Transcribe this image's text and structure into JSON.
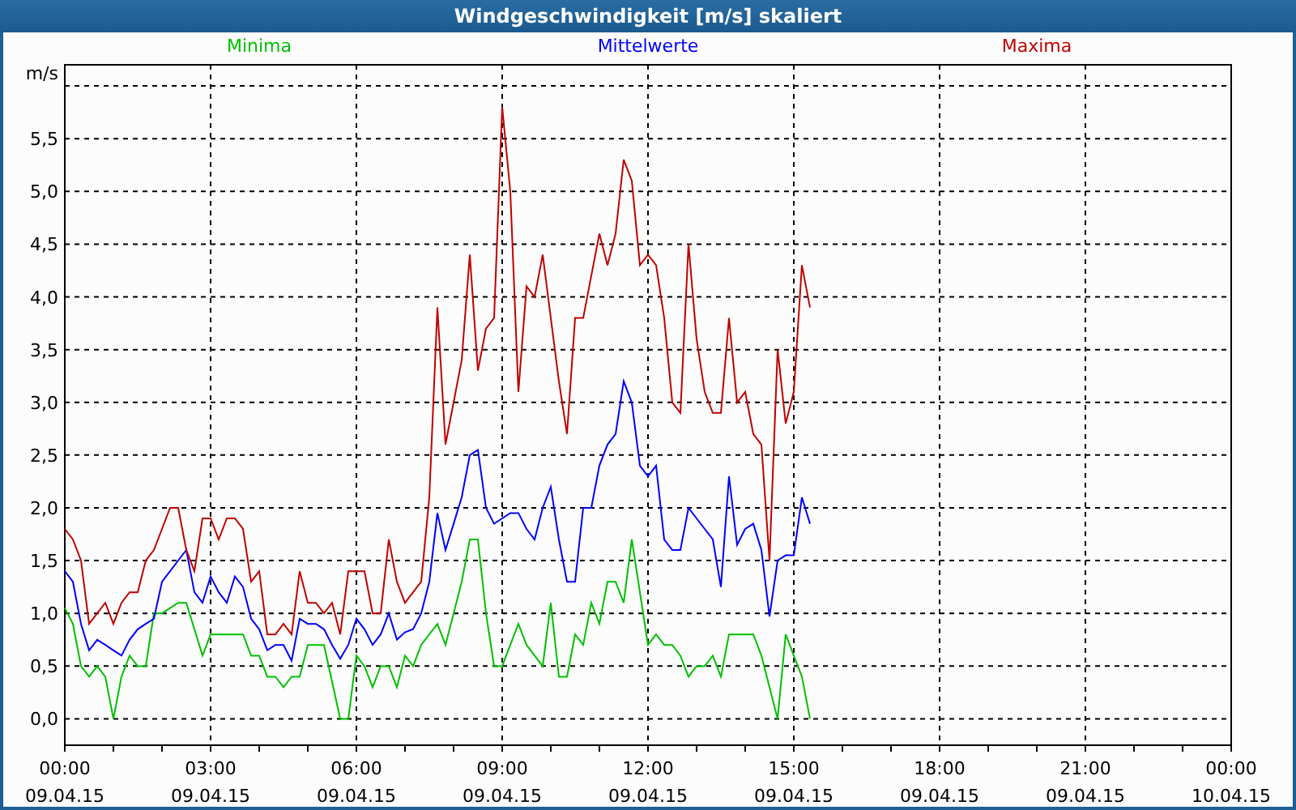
{
  "window": {
    "title": "Windgeschwindigkeit [m/s] skaliert"
  },
  "chart": {
    "chart_data": {
      "type": "line",
      "ylabel": "m/s",
      "grid": true,
      "categories": [
        "00:00\n09.04.15",
        null,
        null,
        null,
        null,
        null,
        null,
        null,
        null,
        null,
        null,
        null,
        null,
        null,
        null,
        null,
        null,
        null,
        "03:00\n09.04.15",
        null,
        null,
        null,
        null,
        null,
        null,
        null,
        null,
        null,
        null,
        null,
        null,
        null,
        null,
        null,
        null,
        null,
        "06:00\n09.04.15",
        null,
        null,
        null,
        null,
        null,
        null,
        null,
        null,
        null,
        null,
        null,
        null,
        null,
        null,
        null,
        null,
        null,
        "09:00\n09.04.15",
        null,
        null,
        null,
        null,
        null,
        null,
        null,
        null,
        null,
        null,
        null,
        null,
        null,
        null,
        null,
        null,
        null,
        "12:00\n09.04.15",
        null,
        null,
        null,
        null,
        null,
        null,
        null,
        null,
        null,
        null,
        null,
        null,
        null,
        null,
        null,
        null,
        null,
        "15:00\n09.04.15",
        null,
        null,
        null,
        null,
        null,
        null,
        null,
        null,
        null,
        null,
        null,
        null,
        null,
        null,
        null,
        null,
        null,
        "18:00\n09.04.15",
        null,
        null,
        null,
        null,
        null,
        null,
        null,
        null,
        null,
        null,
        null,
        null,
        null,
        null,
        null,
        null,
        null,
        "21:00\n09.04.15",
        null,
        null,
        null,
        null,
        null,
        null,
        null,
        null,
        null,
        null,
        null,
        null,
        null,
        null,
        null,
        null,
        null,
        "00:00\n10.04.15"
      ],
      "series": [
        {
          "name": "Minima",
          "color": "#00c000",
          "values": [
            1.05,
            0.9,
            0.5,
            0.4,
            0.5,
            0.4,
            0.0,
            0.4,
            0.6,
            0.5,
            0.5,
            1.0,
            1.0,
            1.05,
            1.1,
            1.1,
            0.85,
            0.6,
            0.8,
            0.8,
            0.8,
            0.8,
            0.8,
            0.6,
            0.6,
            0.4,
            0.4,
            0.3,
            0.4,
            0.4,
            0.7,
            0.7,
            0.7,
            0.35,
            0.0,
            0.0,
            0.6,
            0.5,
            0.3,
            0.5,
            0.5,
            0.3,
            0.6,
            0.5,
            0.7,
            0.8,
            0.9,
            0.7,
            1.0,
            1.3,
            1.7,
            1.7,
            1.0,
            0.5,
            0.5,
            0.7,
            0.9,
            0.7,
            0.6,
            0.5,
            1.1,
            0.4,
            0.4,
            0.8,
            0.7,
            1.1,
            0.9,
            1.3,
            1.3,
            1.1,
            1.7,
            1.2,
            0.7,
            0.8,
            0.7,
            0.7,
            0.6,
            0.4,
            0.5,
            0.5,
            0.6,
            0.4,
            0.8,
            0.8,
            0.8,
            0.8,
            0.6,
            0.3,
            0.0,
            0.8,
            0.6,
            0.4,
            0.0,
            null,
            null,
            null,
            null,
            null,
            null,
            null,
            null,
            null,
            null,
            null,
            null,
            null,
            null,
            null,
            null,
            null,
            null,
            null,
            null,
            null,
            null,
            null,
            null,
            null,
            null,
            null,
            null,
            null,
            null,
            null,
            null,
            null,
            null,
            null,
            null,
            null,
            null,
            null,
            null,
            null,
            null,
            null,
            null,
            null,
            null,
            null,
            null,
            null,
            null,
            null,
            null
          ]
        },
        {
          "name": "Mittelwerte",
          "color": "#0000ff",
          "values": [
            1.4,
            1.3,
            0.9,
            0.65,
            0.75,
            0.7,
            0.65,
            0.6,
            0.75,
            0.85,
            0.9,
            0.95,
            1.3,
            1.4,
            1.5,
            1.6,
            1.2,
            1.1,
            1.35,
            1.2,
            1.1,
            1.35,
            1.25,
            0.95,
            0.85,
            0.65,
            0.7,
            0.7,
            0.55,
            0.95,
            0.9,
            0.9,
            0.85,
            0.7,
            0.57,
            0.7,
            0.95,
            0.85,
            0.7,
            0.8,
            1.0,
            0.75,
            0.82,
            0.85,
            1.0,
            1.3,
            1.95,
            1.6,
            1.85,
            2.1,
            2.5,
            2.55,
            2.0,
            1.85,
            1.9,
            1.95,
            1.95,
            1.8,
            1.7,
            2.0,
            2.2,
            1.7,
            1.3,
            1.3,
            2.0,
            2.0,
            2.4,
            2.6,
            2.7,
            3.2,
            3.0,
            2.4,
            2.3,
            2.4,
            1.7,
            1.6,
            1.6,
            2.0,
            1.9,
            1.8,
            1.7,
            1.25,
            2.3,
            1.65,
            1.8,
            1.85,
            1.6,
            0.97,
            1.5,
            1.55,
            1.55,
            2.1,
            1.85,
            null,
            null,
            null,
            null,
            null,
            null,
            null,
            null,
            null,
            null,
            null,
            null,
            null,
            null,
            null,
            null,
            null,
            null,
            null,
            null,
            null,
            null,
            null,
            null,
            null,
            null,
            null,
            null,
            null,
            null,
            null,
            null,
            null,
            null,
            null,
            null,
            null,
            null,
            null,
            null,
            null,
            null,
            null,
            null,
            null,
            null,
            null,
            null,
            null,
            null,
            null,
            null
          ]
        },
        {
          "name": "Maxima",
          "color": "#c00000",
          "values": [
            1.8,
            1.7,
            1.5,
            0.9,
            1.0,
            1.1,
            0.9,
            1.1,
            1.2,
            1.2,
            1.5,
            1.6,
            1.8,
            2.0,
            2.0,
            1.6,
            1.4,
            1.9,
            1.9,
            1.7,
            1.9,
            1.9,
            1.8,
            1.3,
            1.4,
            0.8,
            0.8,
            0.9,
            0.8,
            1.4,
            1.1,
            1.1,
            1.0,
            1.1,
            0.8,
            1.4,
            1.4,
            1.4,
            1.0,
            1.0,
            1.7,
            1.3,
            1.1,
            1.2,
            1.3,
            2.1,
            3.9,
            2.6,
            3.0,
            3.4,
            4.4,
            3.3,
            3.7,
            3.8,
            5.8,
            5.0,
            3.1,
            4.1,
            4.0,
            4.4,
            3.8,
            3.2,
            2.7,
            3.8,
            3.8,
            4.2,
            4.6,
            4.3,
            4.6,
            5.3,
            5.1,
            4.3,
            4.4,
            4.3,
            3.8,
            3.0,
            2.9,
            4.5,
            3.6,
            3.1,
            2.9,
            2.9,
            3.8,
            3.0,
            3.1,
            2.7,
            2.6,
            1.5,
            3.5,
            2.8,
            3.1,
            4.3,
            3.9,
            null,
            null,
            null,
            null,
            null,
            null,
            null,
            null,
            null,
            null,
            null,
            null,
            null,
            null,
            null,
            null,
            null,
            null,
            null,
            null,
            null,
            null,
            null,
            null,
            null,
            null,
            null,
            null,
            null,
            null,
            null,
            null,
            null,
            null,
            null,
            null,
            null,
            null,
            null,
            null,
            null,
            null,
            null,
            null,
            null,
            null,
            null,
            null,
            null,
            null,
            null,
            null
          ]
        }
      ],
      "ylim": [
        -0.25,
        6.2
      ],
      "yticks": [
        {
          "value": 0,
          "label": "0,0"
        },
        {
          "value": 0.5,
          "label": "0,5"
        },
        {
          "value": 1,
          "label": "1,0"
        },
        {
          "value": 1.5,
          "label": "1,5"
        },
        {
          "value": 2,
          "label": "2,0"
        },
        {
          "value": 2.5,
          "label": "2,5"
        },
        {
          "value": 3,
          "label": "3,0"
        },
        {
          "value": 3.5,
          "label": "3,5"
        },
        {
          "value": 4,
          "label": "4,0"
        },
        {
          "value": 4.5,
          "label": "4,5"
        },
        {
          "value": 5,
          "label": "5,0"
        },
        {
          "value": 5.5,
          "label": "5,5"
        }
      ]
    }
  }
}
